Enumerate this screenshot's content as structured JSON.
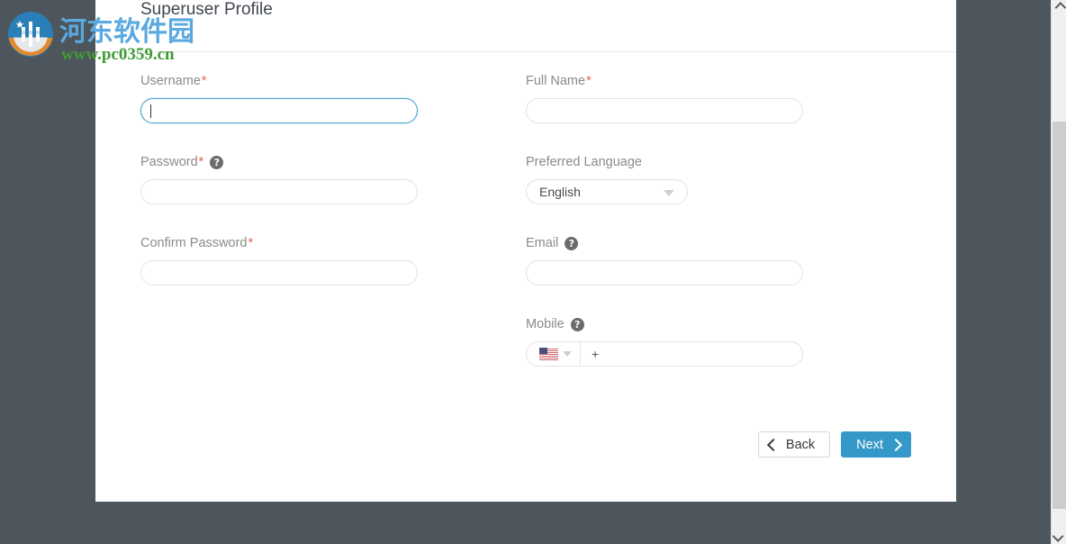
{
  "watermark": {
    "site_name_cn": "河东软件园",
    "site_url": "www.pc0359.cn",
    "logo_icon": "circular-site-logo"
  },
  "panel": {
    "title": "Superuser Profile"
  },
  "form": {
    "fields": {
      "username": {
        "label": "Username",
        "required_mark": "*",
        "value": "",
        "placeholder": "",
        "focused": true
      },
      "full_name": {
        "label": "Full Name",
        "required_mark": "*",
        "value": "",
        "placeholder": ""
      },
      "password": {
        "label": "Password",
        "required_mark": "*",
        "help_icon": "question-mark-icon",
        "value": "",
        "placeholder": ""
      },
      "preferred_language": {
        "label": "Preferred Language",
        "selected": "English",
        "dropdown_icon": "triangle-down-icon"
      },
      "confirm_password": {
        "label": "Confirm Password",
        "required_mark": "*",
        "value": "",
        "placeholder": ""
      },
      "email": {
        "label": "Email",
        "help_icon": "question-mark-icon",
        "value": "",
        "placeholder": ""
      },
      "mobile": {
        "label": "Mobile",
        "help_icon": "question-mark-icon",
        "country_flag": "us-flag-icon",
        "dropdown_icon": "triangle-down-icon",
        "value": "+",
        "placeholder": ""
      }
    }
  },
  "buttons": {
    "back": {
      "label": "Back",
      "icon": "chevron-left-icon"
    },
    "next": {
      "label": "Next",
      "icon": "chevron-right-icon"
    }
  },
  "scrollbar": {
    "up_icon": "chevron-up-icon",
    "down_icon": "chevron-down-icon"
  },
  "colors": {
    "page_background": "#4d565c",
    "panel_background": "#ffffff",
    "accent_primary": "#3498c8",
    "focus_border": "#49a4d1",
    "required_asterisk": "#ea6153",
    "label_text": "#8b8b8b",
    "title_text": "#3f4650",
    "watermark_cn": "#5aa9e0",
    "watermark_url": "#3f9c35"
  }
}
